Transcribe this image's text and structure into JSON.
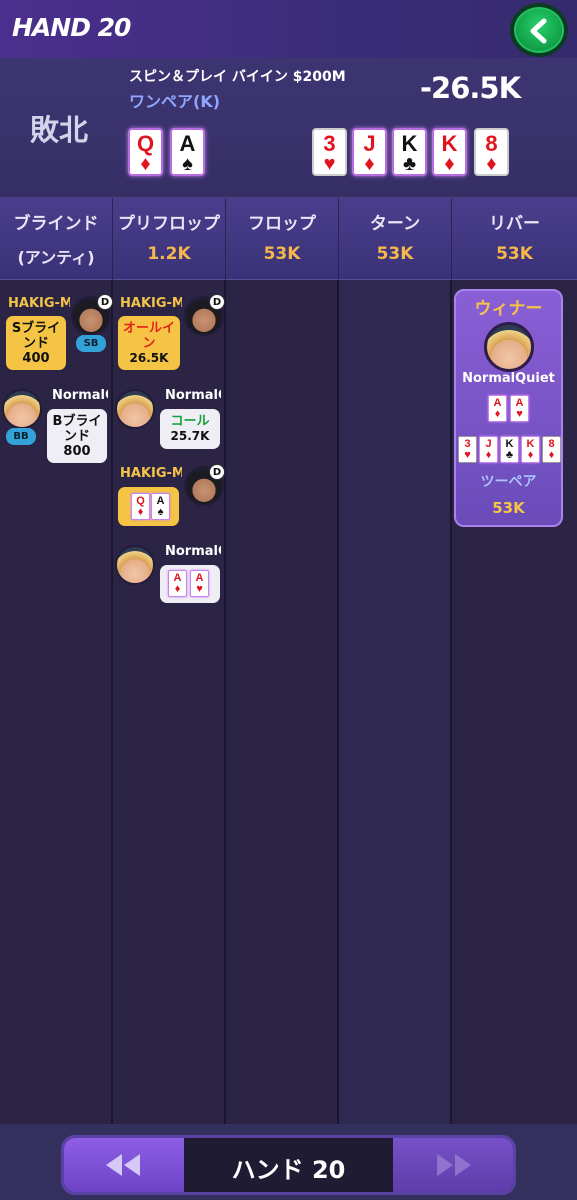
{
  "header": {
    "title": "HAND 20",
    "back_icon": "chevron-left-icon"
  },
  "summary": {
    "result": "敗北",
    "game_info": "スピン＆プレイ バイイン $200M",
    "hand_rank": "ワンペア(K)",
    "net_amount": "-26.5K",
    "hole_cards": [
      {
        "rank": "Q",
        "suit": "♦",
        "color": "red"
      },
      {
        "rank": "A",
        "suit": "♠",
        "color": "black"
      }
    ],
    "board_cards": [
      {
        "rank": "3",
        "suit": "♥",
        "color": "red"
      },
      {
        "rank": "J",
        "suit": "♦",
        "color": "red"
      },
      {
        "rank": "K",
        "suit": "♣",
        "color": "black"
      },
      {
        "rank": "K",
        "suit": "♦",
        "color": "red"
      },
      {
        "rank": "8",
        "suit": "♦",
        "color": "red"
      }
    ]
  },
  "columns": [
    {
      "name": "ブラインド",
      "sub": "(アンティ)"
    },
    {
      "name": "プリフロップ",
      "pot": "1.2K"
    },
    {
      "name": "フロップ",
      "pot": "53K"
    },
    {
      "name": "ターン",
      "pot": "53K"
    },
    {
      "name": "リバー",
      "pot": "53K"
    }
  ],
  "blinds": {
    "p1": {
      "name": "HAKIG-M",
      "dealer": "D",
      "position": "SB",
      "action": [
        "Sブライ",
        "ンド",
        "400"
      ]
    },
    "p2": {
      "name": "NormalC",
      "position": "BB",
      "action": [
        "Bブライ",
        "ンド",
        "800"
      ]
    }
  },
  "preflop": {
    "a1": {
      "name": "HAKIG-M",
      "dealer": "D",
      "action": [
        "オールイ",
        "ン"
      ],
      "amount": "26.5K"
    },
    "a2": {
      "name": "NormalC",
      "action": "コール",
      "amount": "25.7K"
    },
    "a3": {
      "name": "HAKIG-M",
      "dealer": "D",
      "cards": [
        {
          "rank": "Q",
          "suit": "♦",
          "color": "red"
        },
        {
          "rank": "A",
          "suit": "♠",
          "color": "black"
        }
      ]
    },
    "a4": {
      "name": "NormalC",
      "cards": [
        {
          "rank": "A",
          "suit": "♦",
          "color": "red"
        },
        {
          "rank": "A",
          "suit": "♥",
          "color": "red"
        }
      ]
    }
  },
  "winner": {
    "title": "ウィナー",
    "name": "NormalQuiet",
    "hole_cards": [
      {
        "rank": "A",
        "suit": "♦",
        "color": "red"
      },
      {
        "rank": "A",
        "suit": "♥",
        "color": "red"
      }
    ],
    "board_cards": [
      {
        "rank": "3",
        "suit": "♥",
        "color": "red"
      },
      {
        "rank": "J",
        "suit": "♦",
        "color": "red"
      },
      {
        "rank": "K",
        "suit": "♣",
        "color": "black"
      },
      {
        "rank": "K",
        "suit": "♦",
        "color": "red"
      },
      {
        "rank": "8",
        "suit": "♦",
        "color": "red"
      }
    ],
    "hand_rank": "ツーペア",
    "pot": "53K"
  },
  "footer": {
    "label": "ハンド 20",
    "prev_icon": "rewind-icon",
    "next_icon": "fast-forward-icon"
  },
  "colors": {
    "accent_yellow": "#f6c444",
    "accent_purple": "#8a5fd6",
    "back_green": "#1fb95a"
  }
}
